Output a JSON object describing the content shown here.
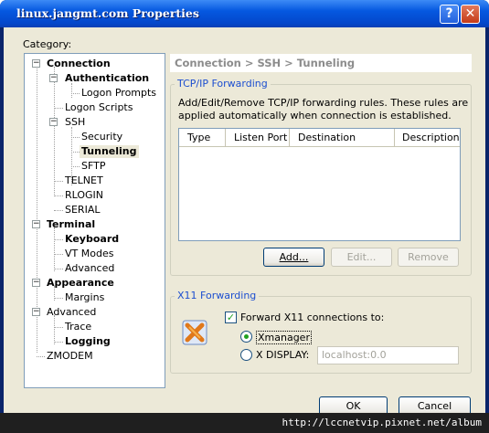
{
  "window": {
    "title": "linux.jangmt.com Properties",
    "help_label": "?",
    "close_label": "✕"
  },
  "category_label": "Category:",
  "tree": [
    {
      "label": "Connection",
      "expanded": true
    },
    {
      "label": "Authentication",
      "expanded": true
    },
    {
      "label": "Logon Prompts"
    },
    {
      "label": "Logon Scripts"
    },
    {
      "label": "SSH",
      "expanded": true
    },
    {
      "label": "Security"
    },
    {
      "label": "Tunneling",
      "selected": true
    },
    {
      "label": "SFTP"
    },
    {
      "label": "TELNET"
    },
    {
      "label": "RLOGIN"
    },
    {
      "label": "SERIAL"
    },
    {
      "label": "Terminal",
      "expanded": true
    },
    {
      "label": "Keyboard"
    },
    {
      "label": "VT Modes"
    },
    {
      "label": "Advanced"
    },
    {
      "label": "Appearance",
      "expanded": true
    },
    {
      "label": "Margins"
    },
    {
      "label": "Advanced",
      "expanded": true
    },
    {
      "label": "Trace"
    },
    {
      "label": "Logging"
    },
    {
      "label": "ZMODEM"
    }
  ],
  "breadcrumb": "Connection > SSH > Tunneling",
  "tcpip": {
    "title": "TCP/IP Forwarding",
    "description_line1": "Add/Edit/Remove TCP/IP forwarding rules. These rules are",
    "description_line2": "applied automatically when connection is established.",
    "columns": [
      "Type",
      "Listen Port",
      "Destination",
      "Description"
    ],
    "add_label": "Add...",
    "edit_label": "Edit...",
    "remove_label": "Remove"
  },
  "x11": {
    "title": "X11 Forwarding",
    "forward_label": "Forward X11 connections to:",
    "forward_checked": true,
    "xmanager_label": "Xmanager",
    "xdisplay_label": "X DISPLAY:",
    "xdisplay_value": "localhost:0.0"
  },
  "ok_label": "OK",
  "cancel_label": "Cancel",
  "watermark": "http://lccnetvip.pixnet.net/album",
  "colors": {
    "titlebar": "#0558e0",
    "group_title": "#1d4fd0",
    "check": "#21a121"
  }
}
